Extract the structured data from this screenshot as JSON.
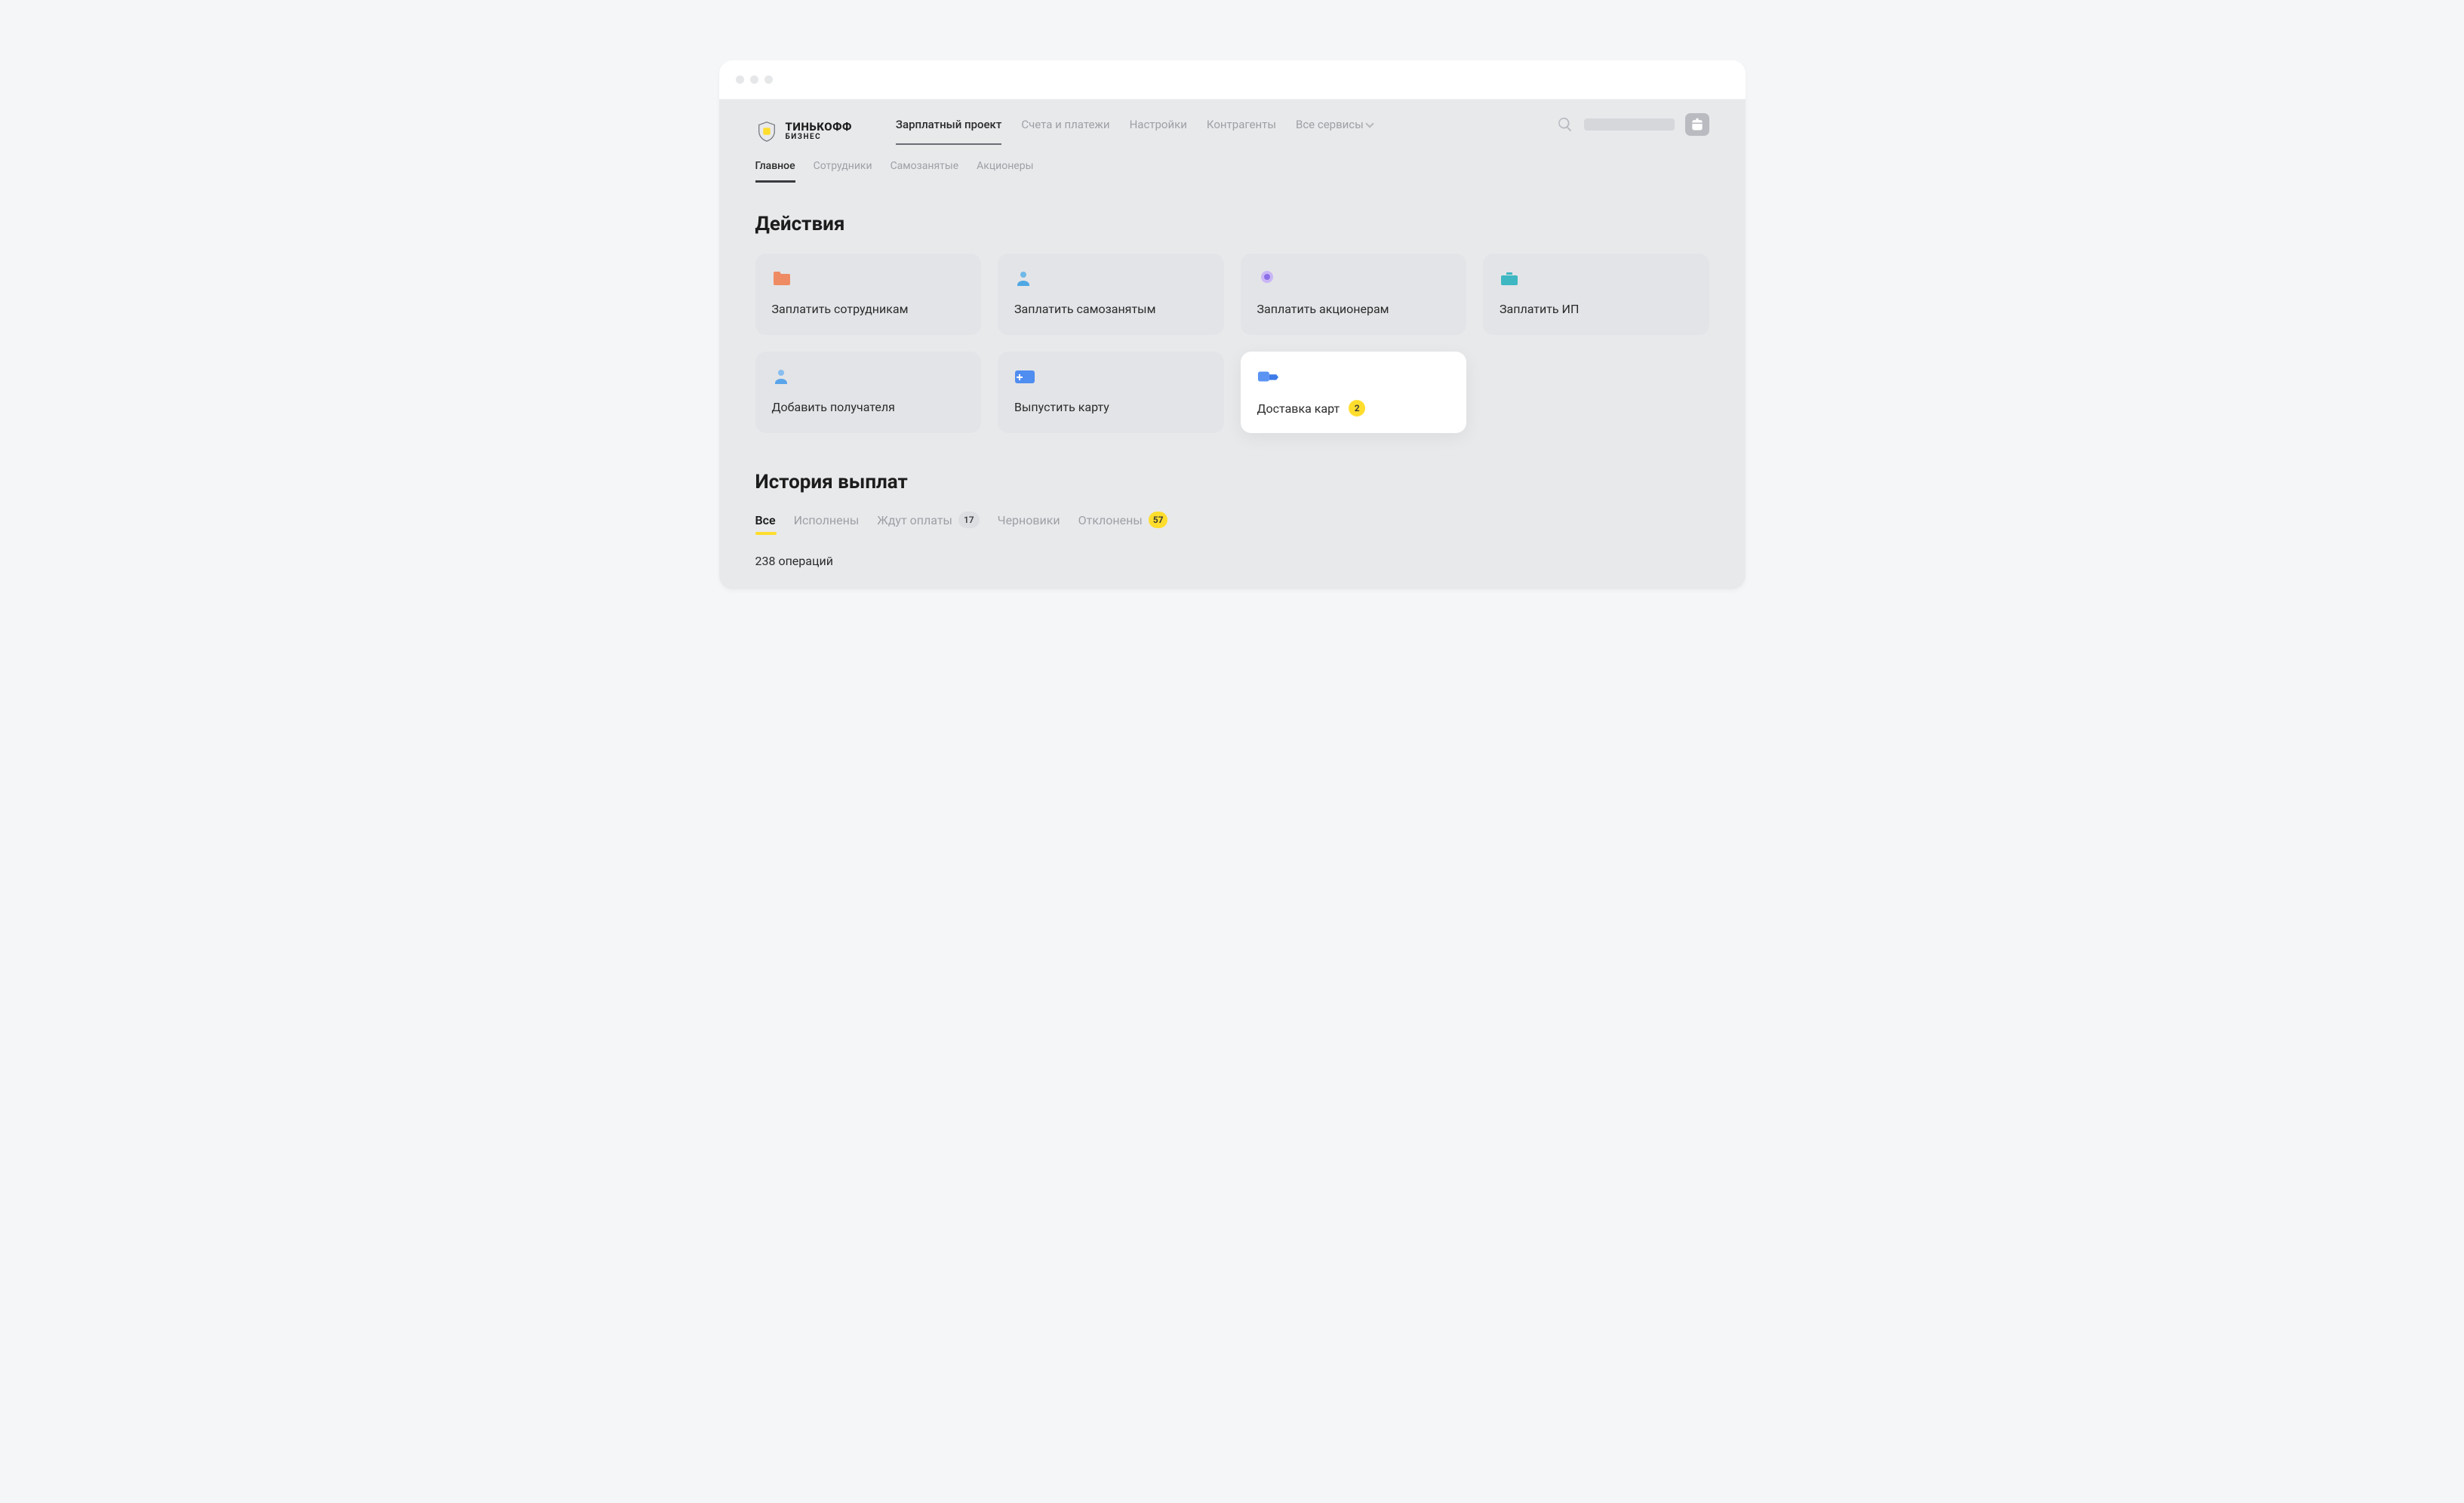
{
  "logo": {
    "top": "ТИНЬКОФФ",
    "sub": "БИЗНЕС"
  },
  "mainNav": {
    "items": [
      {
        "label": "Зарплатный проект",
        "active": true,
        "hasChevron": false
      },
      {
        "label": "Счета и платежи",
        "active": false,
        "hasChevron": false
      },
      {
        "label": "Настройки",
        "active": false,
        "hasChevron": false
      },
      {
        "label": "Контрагенты",
        "active": false,
        "hasChevron": false
      },
      {
        "label": "Все сервисы",
        "active": false,
        "hasChevron": true
      }
    ]
  },
  "subNav": {
    "items": [
      {
        "label": "Главное",
        "active": true
      },
      {
        "label": "Сотрудники",
        "active": false
      },
      {
        "label": "Самозанятые",
        "active": false
      },
      {
        "label": "Акционеры",
        "active": false
      }
    ]
  },
  "actions": {
    "title": "Действия",
    "cards": [
      {
        "icon": "folder",
        "label": "Заплатить сотрудникам",
        "highlight": false
      },
      {
        "icon": "person-self",
        "label": "Заплатить самозанятым",
        "highlight": false
      },
      {
        "icon": "shareholder",
        "label": "Заплатить акционерам",
        "highlight": false
      },
      {
        "icon": "briefcase",
        "label": "Заплатить ИП",
        "highlight": false
      },
      {
        "icon": "add-person",
        "label": "Добавить получателя",
        "highlight": false
      },
      {
        "icon": "card-plus",
        "label": "Выпустить карту",
        "highlight": false
      },
      {
        "icon": "delivery",
        "label": "Доставка карт",
        "highlight": true,
        "badge": "2"
      }
    ]
  },
  "history": {
    "title": "История выплат",
    "tabs": [
      {
        "label": "Все",
        "active": true
      },
      {
        "label": "Исполнены",
        "active": false
      },
      {
        "label": "Ждут оплаты",
        "active": false,
        "count": "17",
        "countColor": "gray"
      },
      {
        "label": "Черновики",
        "active": false
      },
      {
        "label": "Отклонены",
        "active": false,
        "count": "57",
        "countColor": "yellow"
      }
    ],
    "summary": "238 операций"
  }
}
